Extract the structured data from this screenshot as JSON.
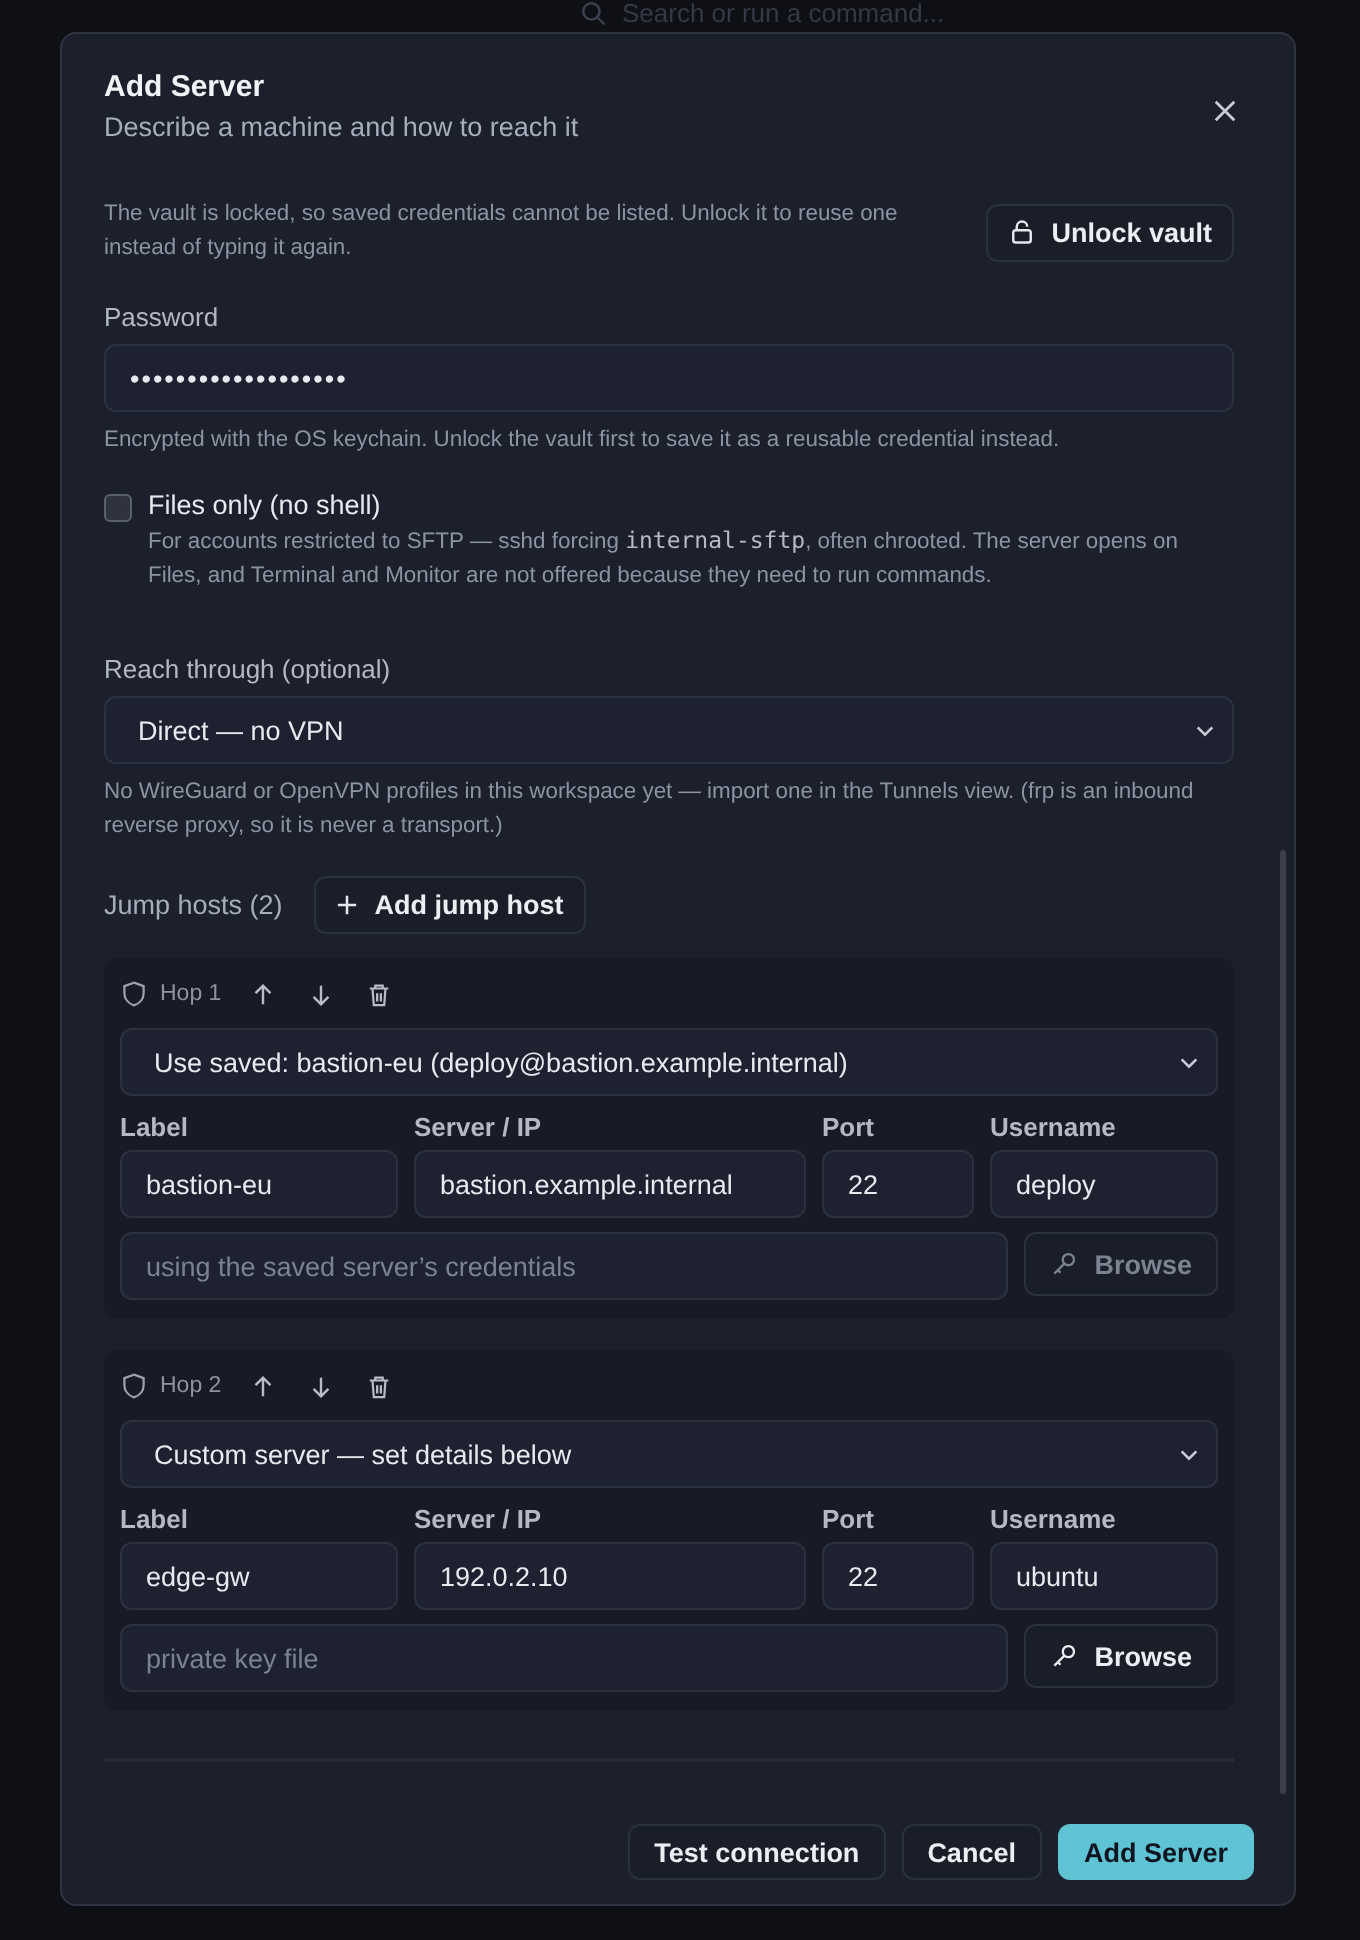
{
  "background": {
    "search_placeholder": "Search or run a command..."
  },
  "dialog": {
    "title": "Add Server",
    "subtitle": "Describe a machine and how to reach it"
  },
  "vault": {
    "text": "The vault is locked, so saved credentials cannot be listed. Unlock it to reuse one instead of typing it again.",
    "button": "Unlock vault"
  },
  "password": {
    "label": "Password",
    "value": "•••••••••••••••••••",
    "help": "Encrypted with the OS keychain. Unlock the vault first to save it as a reusable credential instead."
  },
  "files_only": {
    "label": "Files only (no shell)",
    "checked": false,
    "help_before": "For accounts restricted to SFTP — sshd forcing ",
    "help_code": "internal-sftp",
    "help_after": ", often chrooted. The server opens on Files, and Terminal and Monitor are not offered because they need to run commands."
  },
  "reach": {
    "label": "Reach through (optional)",
    "value": "Direct — no VPN",
    "help": "No WireGuard or OpenVPN profiles in this workspace yet — import one in the Tunnels view. (frp is an inbound reverse proxy, so it is never a transport.)"
  },
  "jump_hosts": {
    "label": "Jump hosts (2)",
    "add_button": "Add jump host",
    "hops": [
      {
        "title": "Hop 1",
        "source": "Use saved: bastion-eu (deploy@bastion.example.internal)",
        "label_caption": "Label",
        "label": "bastion-eu",
        "server_caption": "Server / IP",
        "server": "bastion.example.internal",
        "port_caption": "Port",
        "port": "22",
        "user_caption": "Username",
        "user": "deploy",
        "key_placeholder": "using the saved server’s credentials",
        "browse": "Browse",
        "browse_disabled": true
      },
      {
        "title": "Hop 2",
        "source": "Custom server — set details below",
        "label_caption": "Label",
        "label": "edge-gw",
        "server_caption": "Server / IP",
        "server": "192.0.2.10",
        "port_caption": "Port",
        "port": "22",
        "user_caption": "Username",
        "user": "ubuntu",
        "key_placeholder": "private key file",
        "browse": "Browse",
        "browse_disabled": false
      }
    ]
  },
  "footer": {
    "buttons": [
      {
        "label": "Test connection",
        "kind": "secondary"
      },
      {
        "label": "Cancel",
        "kind": "secondary"
      },
      {
        "label": "Add Server",
        "kind": "primary"
      }
    ]
  }
}
